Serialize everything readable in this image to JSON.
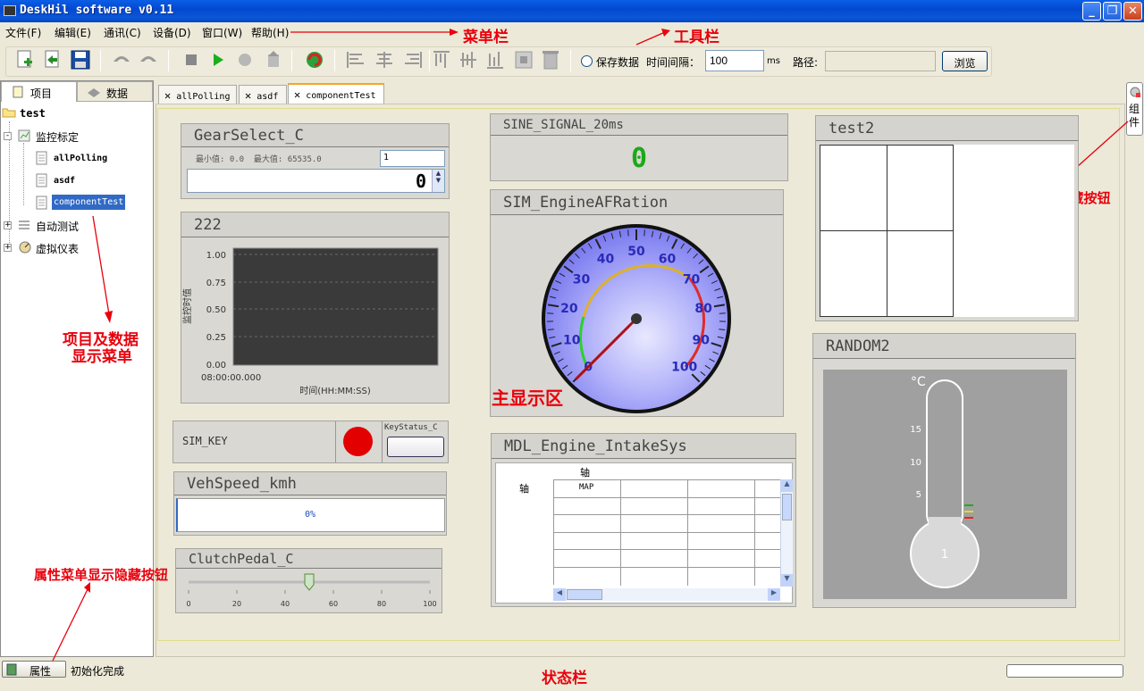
{
  "window": {
    "title": "DeskHil software v0.11"
  },
  "menu": [
    "文件(F)",
    "编辑(E)",
    "通讯(C)",
    "设备(D)",
    "窗口(W)",
    "帮助(H)"
  ],
  "toolbar": {
    "save_data_label": "保存数据",
    "interval_label": "时间间隔：",
    "interval_value": "100",
    "interval_unit": "ms",
    "path_label": "路径:",
    "browse_label": "浏览"
  },
  "annotations": {
    "menubar": "菜单栏",
    "toolbar": "工具栏",
    "project_menu_1": "项目及数据",
    "project_menu_2": "显示菜单",
    "main_area": "主显示区",
    "component_toggle": "组件菜单显示/隐藏按钮",
    "property_toggle": "属性菜单显示隐藏按钮",
    "statusbar": "状态栏"
  },
  "left_panel": {
    "tabs": [
      "项目",
      "数据"
    ],
    "tree": {
      "root": "test",
      "items": [
        {
          "label": "监控标定",
          "children": [
            "allPolling",
            "asdf",
            "componentTest"
          ]
        },
        {
          "label": "自动测试"
        },
        {
          "label": "虚拟仪表"
        }
      ],
      "selected": "componentTest"
    }
  },
  "doc_tabs": [
    "allPolling",
    "asdf",
    "componentTest"
  ],
  "active_tab": "componentTest",
  "side_toggle_label": "组件",
  "widgets": {
    "gearselect": {
      "title": "GearSelect_C",
      "range": "最小值: 0.0  最大值: 65535.0",
      "step": "1",
      "value": "0"
    },
    "chart222": {
      "title": "222",
      "ylabel": "监控时值",
      "xlabel": "时间(HH:MM:SS)",
      "xtick": "08:00:00.000"
    },
    "simkey": {
      "label": "SIM_KEY",
      "status_label": "KeyStatus_C"
    },
    "vehspeed": {
      "title": "VehSpeed_kmh",
      "progress_text": "0%",
      "progress": 0
    },
    "clutch": {
      "title": "ClutchPedal_C",
      "ticks": [
        "0",
        "20",
        "40",
        "60",
        "80",
        "100"
      ],
      "value": 50
    },
    "sine": {
      "title": "SINE_SIGNAL_20ms",
      "value": "0"
    },
    "afration": {
      "title": "SIM_EngineAFRation",
      "ticks": [
        "0",
        "10",
        "20",
        "30",
        "40",
        "50",
        "60",
        "70",
        "80",
        "90",
        "100"
      ],
      "value": 0
    },
    "intake": {
      "title": "MDL_Engine_IntakeSys",
      "axis_top": "轴",
      "axis_left": "轴",
      "col1": "MAP"
    },
    "test2": {
      "title": "test2"
    },
    "random2": {
      "title": "RANDOM2",
      "unit": "°C",
      "ticks": [
        "15",
        "10",
        "5"
      ],
      "bulb_value": "1"
    }
  },
  "status": {
    "property_button": "属性",
    "message": "初始化完成"
  },
  "colors": {
    "title_blue": "#0A5FE6",
    "annotation_red": "#E8000C",
    "gauge_face": "#8C8CF5",
    "led_green": "#1CA81C",
    "key_red": "#E20000"
  }
}
